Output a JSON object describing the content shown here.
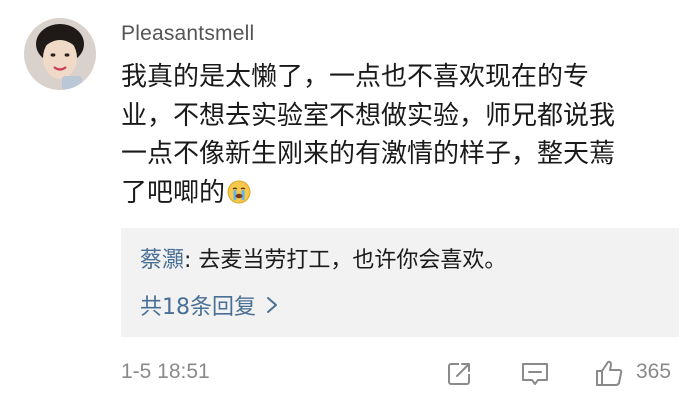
{
  "comment": {
    "username": "Pleasantsmell",
    "lines": [
      "我真的是太懒了，一点也不喜欢现在的专",
      "业，不想去实验室不想做实验，师兄都说我",
      "一点不像新生刚来的有激情的样子，整天蔫",
      "了吧唧的"
    ],
    "emoji": "crying-face-emoji",
    "timestamp": "1-5 18:51",
    "like_count": "365"
  },
  "reply": {
    "author": "蔡灝",
    "separator": ": ",
    "text": "去麦当劳打工，也许你会喜欢。",
    "more_label": "共18条回复"
  },
  "icons": {
    "share": "share-icon",
    "reply": "comment-icon",
    "like": "thumbs-up-icon",
    "more": "chevron-right-icon"
  },
  "colors": {
    "link": "#4a6f95",
    "text": "#1a1a1a",
    "meta": "#8a8a8a",
    "reply_bg": "#f2f2f2"
  }
}
